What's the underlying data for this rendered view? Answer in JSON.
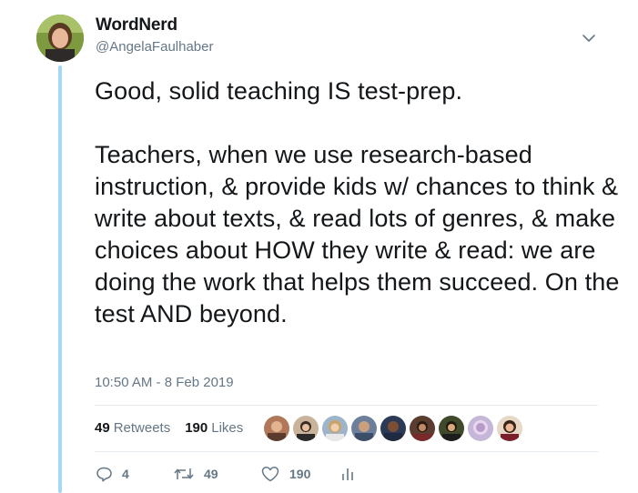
{
  "author": {
    "display_name": "WordNerd",
    "handle": "@AngelaFaulhaber"
  },
  "tweet": {
    "text": "Good, solid teaching IS test-prep.\n\nTeachers, when we use research-based instruction, & provide kids w/ chances to think & write about texts, & read lots of genres, & make choices about HOW they write & read: we are doing the work that helps them succeed. On the test AND beyond.",
    "timestamp": "10:50 AM - 8 Feb 2019"
  },
  "stats": {
    "retweets_count": "49",
    "retweets_label": "Retweets",
    "likes_count": "190",
    "likes_label": "Likes"
  },
  "actions": {
    "replies": "4",
    "retweets": "49",
    "likes": "190"
  },
  "icons": {
    "caret": "chevron-down-icon",
    "reply": "reply-icon",
    "retweet": "retweet-icon",
    "like": "heart-icon",
    "analytics": "analytics-icon"
  },
  "colors": {
    "thread_line": "#a5d8f3",
    "secondary_text": "#657786",
    "primary_text": "#14171a"
  }
}
